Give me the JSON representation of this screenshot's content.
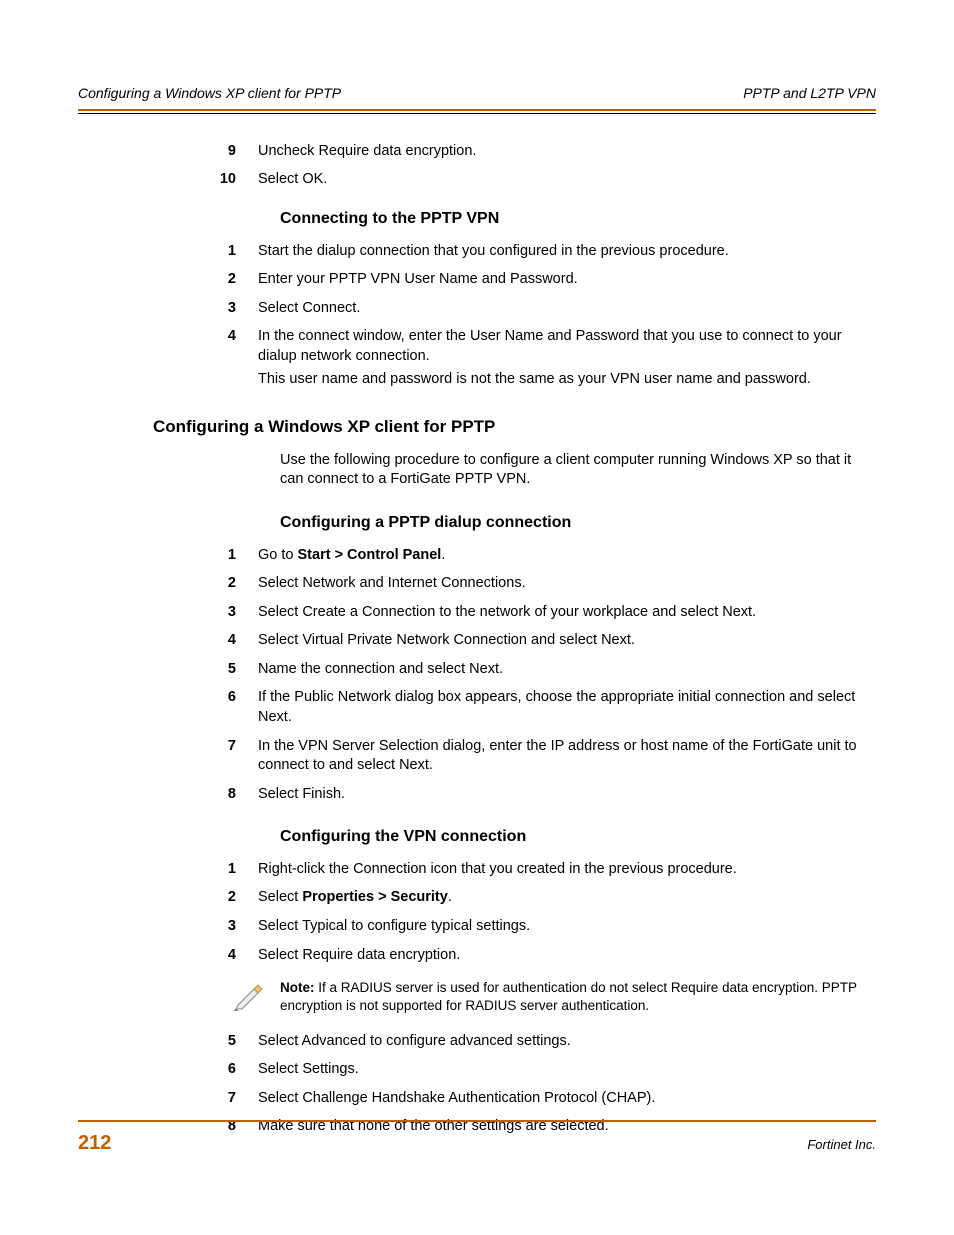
{
  "header": {
    "left": "Configuring a Windows XP client for PPTP",
    "right": "PPTP and L2TP VPN"
  },
  "topSteps": [
    {
      "n": "9",
      "t": "Uncheck Require data encryption."
    },
    {
      "n": "10",
      "t": "Select OK."
    }
  ],
  "sec1": {
    "title": "Connecting to the PPTP VPN",
    "steps": [
      {
        "n": "1",
        "t": "Start the dialup connection that you configured in the previous procedure."
      },
      {
        "n": "2",
        "t": "Enter your PPTP VPN User Name and Password."
      },
      {
        "n": "3",
        "t": "Select Connect."
      },
      {
        "n": "4",
        "t": "In the connect window, enter the User Name and Password that you use to connect to your dialup network connection.",
        "t2": "This user name and password is not the same as your VPN user name and password."
      }
    ]
  },
  "sec2": {
    "title": "Configuring a Windows XP client for PPTP",
    "intro": "Use the following procedure to configure a client computer running Windows XP so that it can connect to a FortiGate PPTP VPN."
  },
  "sec3": {
    "title": "Configuring a PPTP dialup connection",
    "steps": [
      {
        "n": "1",
        "pre": "Go to ",
        "bold": "Start > Control Panel",
        "post": "."
      },
      {
        "n": "2",
        "t": "Select Network and Internet Connections."
      },
      {
        "n": "3",
        "t": "Select Create a Connection to the network of your workplace and select Next."
      },
      {
        "n": "4",
        "t": "Select Virtual Private Network Connection and select Next."
      },
      {
        "n": "5",
        "t": "Name the connection and select Next."
      },
      {
        "n": "6",
        "t": "If the Public Network dialog box appears, choose the appropriate initial connection and select Next."
      },
      {
        "n": "7",
        "t": "In the VPN Server Selection dialog, enter the IP address or host name of the FortiGate unit to connect to and select Next."
      },
      {
        "n": "8",
        "t": "Select Finish."
      }
    ]
  },
  "sec4": {
    "title": "Configuring the VPN connection",
    "stepsA": [
      {
        "n": "1",
        "t": "Right-click the Connection icon that you created in the previous procedure."
      },
      {
        "n": "2",
        "pre": "Select ",
        "bold": "Properties > Security",
        "post": "."
      },
      {
        "n": "3",
        "t": "Select Typical to configure typical settings."
      },
      {
        "n": "4",
        "t": "Select Require data encryption."
      }
    ],
    "note": {
      "label": "Note:",
      "text": " If a RADIUS server is used for authentication do not select Require data encryption. PPTP encryption is not supported for RADIUS server authentication."
    },
    "stepsB": [
      {
        "n": "5",
        "t": "Select Advanced to configure advanced settings."
      },
      {
        "n": "6",
        "t": "Select Settings."
      },
      {
        "n": "7",
        "t": "Select Challenge Handshake Authentication Protocol (CHAP)."
      },
      {
        "n": "8",
        "t": "Make sure that none of the other settings are selected."
      }
    ]
  },
  "footer": {
    "page": "212",
    "right": "Fortinet Inc."
  }
}
